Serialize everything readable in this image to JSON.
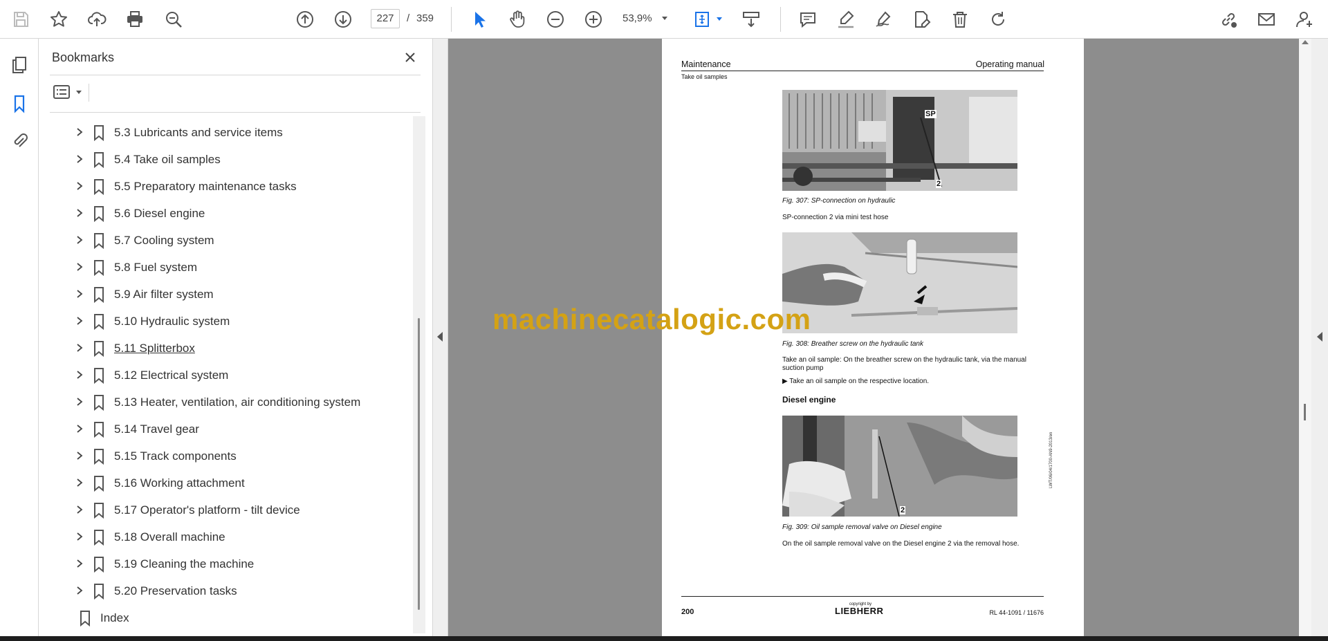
{
  "toolbar": {
    "page_current": "227",
    "page_separator": "/",
    "page_total": "359",
    "zoom": "53,9%",
    "icons": [
      "save-icon",
      "bookmark-star-icon",
      "upload-icon",
      "print-icon",
      "zoom-search-icon",
      "page-up-icon",
      "page-down-icon",
      "select-cursor-icon",
      "hand-icon",
      "zoom-out-icon",
      "zoom-in-icon",
      "fit-page-icon",
      "scroll-mode-icon",
      "comment-icon",
      "highlight-icon",
      "draw-icon",
      "fill-sign-icon",
      "delete-icon",
      "rotate-icon",
      "link-icon",
      "mail-icon",
      "account-icon"
    ]
  },
  "rail": {
    "icons": [
      "pages-icon",
      "bookmarks-icon",
      "attachments-icon"
    ]
  },
  "bookmarks": {
    "title": "Bookmarks",
    "items": [
      {
        "label": "5.3 Lubricants and service items",
        "expandable": true
      },
      {
        "label": "5.4 Take oil samples",
        "expandable": true
      },
      {
        "label": "5.5 Preparatory maintenance tasks",
        "expandable": true
      },
      {
        "label": "5.6 Diesel engine",
        "expandable": true
      },
      {
        "label": "5.7 Cooling system",
        "expandable": true
      },
      {
        "label": "5.8 Fuel system",
        "expandable": true
      },
      {
        "label": "5.9 Air filter system",
        "expandable": true
      },
      {
        "label": "5.10 Hydraulic system",
        "expandable": true
      },
      {
        "label": "5.11 Splitterbox",
        "expandable": true
      },
      {
        "label": "5.12 Electrical system",
        "expandable": true
      },
      {
        "label": "5.13 Heater, ventilation, air conditioning system",
        "expandable": true
      },
      {
        "label": "5.14 Travel gear",
        "expandable": true
      },
      {
        "label": "5.15 Track components",
        "expandable": true
      },
      {
        "label": "5.16 Working attachment",
        "expandable": true
      },
      {
        "label": "5.17 Operator's platform - tilt device",
        "expandable": true
      },
      {
        "label": "5.18 Overall machine",
        "expandable": true
      },
      {
        "label": "5.19 Cleaning the machine",
        "expandable": true
      },
      {
        "label": "5.20 Preservation tasks",
        "expandable": true
      },
      {
        "label": "Index",
        "expandable": false
      }
    ]
  },
  "page": {
    "header_left": "Maintenance",
    "header_right": "Operating manual",
    "header_sub": "Take oil samples",
    "fig307_caption": "Fig. 307: SP-connection on hydraulic",
    "fig307_label_sp": "SP",
    "fig307_label_2": "2",
    "text1": "SP-connection 2 via mini test hose",
    "fig308_caption": "Fig. 308: Breather screw on the hydraulic tank",
    "text2": "Take an oil sample: On the breather screw on the hydraulic tank, via the manual suction pump",
    "bullet": "▶  Take an oil sample on the respective location.",
    "heading_diesel": "Diesel engine",
    "fig309_caption": "Fig. 309: Oil sample removal valve on Diesel engine",
    "fig309_label_2": "2",
    "text3": "On the oil sample removal valve on the Diesel engine 2 via the removal hose.",
    "side_code": "LWT/06/04/1700-AN9-2013/en",
    "page_number": "200",
    "copyright": "copyright by",
    "logo": "LIEBHERR",
    "doc_ref": "RL 44-1091 / 11676"
  },
  "watermark": "machinecatalogic.com"
}
